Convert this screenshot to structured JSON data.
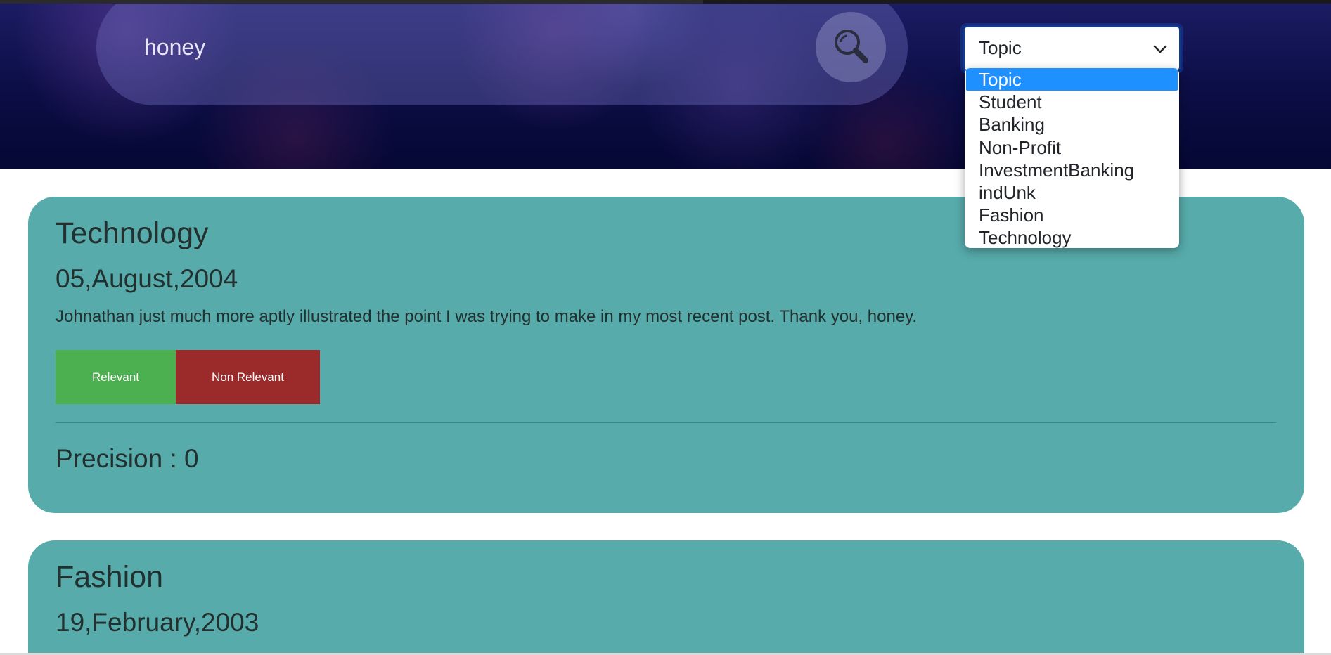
{
  "search": {
    "query": "honey"
  },
  "topic_select": {
    "selected": "Topic",
    "options": [
      "Topic",
      "Student",
      "Banking",
      "Non-Profit",
      "InvestmentBanking",
      "indUnk",
      "Fashion",
      "Technology"
    ]
  },
  "results": [
    {
      "topic": "Technology",
      "date": "05,August,2004",
      "text": "Johnathan just much more aptly illustrated the point I was trying to make in my most recent post. Thank you, honey.",
      "relevant_label": "Relevant",
      "non_relevant_label": "Non Relevant",
      "precision_label": "Precision : 0"
    },
    {
      "topic": "Fashion",
      "date": "19,February,2003"
    }
  ],
  "colors": {
    "card_bg": "#57abab",
    "relevant_btn": "#4caf50",
    "non_relevant_btn": "#9b2b2b",
    "dropdown_highlight": "#1e90ff"
  },
  "icons": {
    "search": "search-icon",
    "chevron": "chevron-down-icon"
  }
}
